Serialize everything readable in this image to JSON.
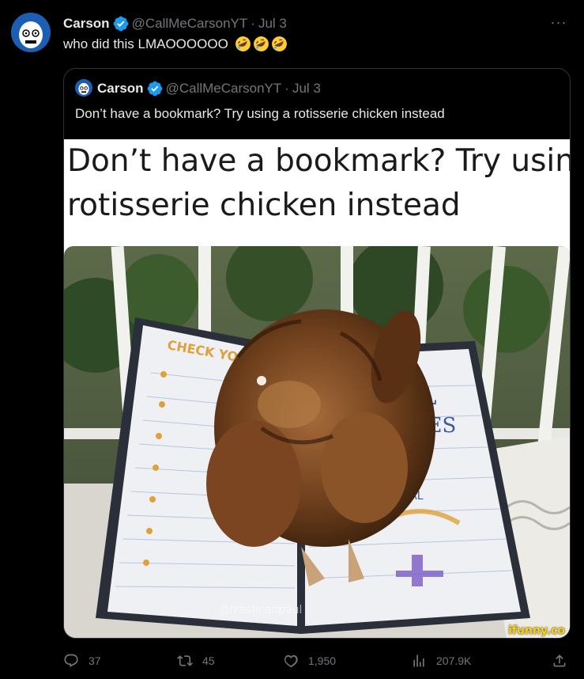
{
  "tweet": {
    "author_name": "Carson",
    "author_handle": "@CallMeCarsonYT",
    "separator": "·",
    "date": "Jul 3",
    "text": "who did this LMAOOOOOO",
    "emoji": [
      "rofl-emoji",
      "rofl-emoji",
      "rofl-emoji"
    ]
  },
  "quote": {
    "author_name": "Carson",
    "author_handle": "@CallMeCarsonYT",
    "separator": "·",
    "date": "Jul 3",
    "text": "Don’t have a bookmark? Try using a rotisserie chicken instead",
    "media": {
      "caption_line1": "Don’t have a bookmark? Try using a",
      "caption_line2": "rotisserie chicken instead",
      "watermark_user": "@trashcanpaul",
      "watermark_site": "ifunny.co"
    }
  },
  "actions": {
    "replies": "37",
    "reposts": "45",
    "likes": "1,950",
    "views": "207.9K"
  },
  "colors": {
    "background": "#000000",
    "text": "#e7e9ea",
    "muted": "#71767b",
    "verified": "#1d9bf0",
    "border": "#2f3336"
  }
}
